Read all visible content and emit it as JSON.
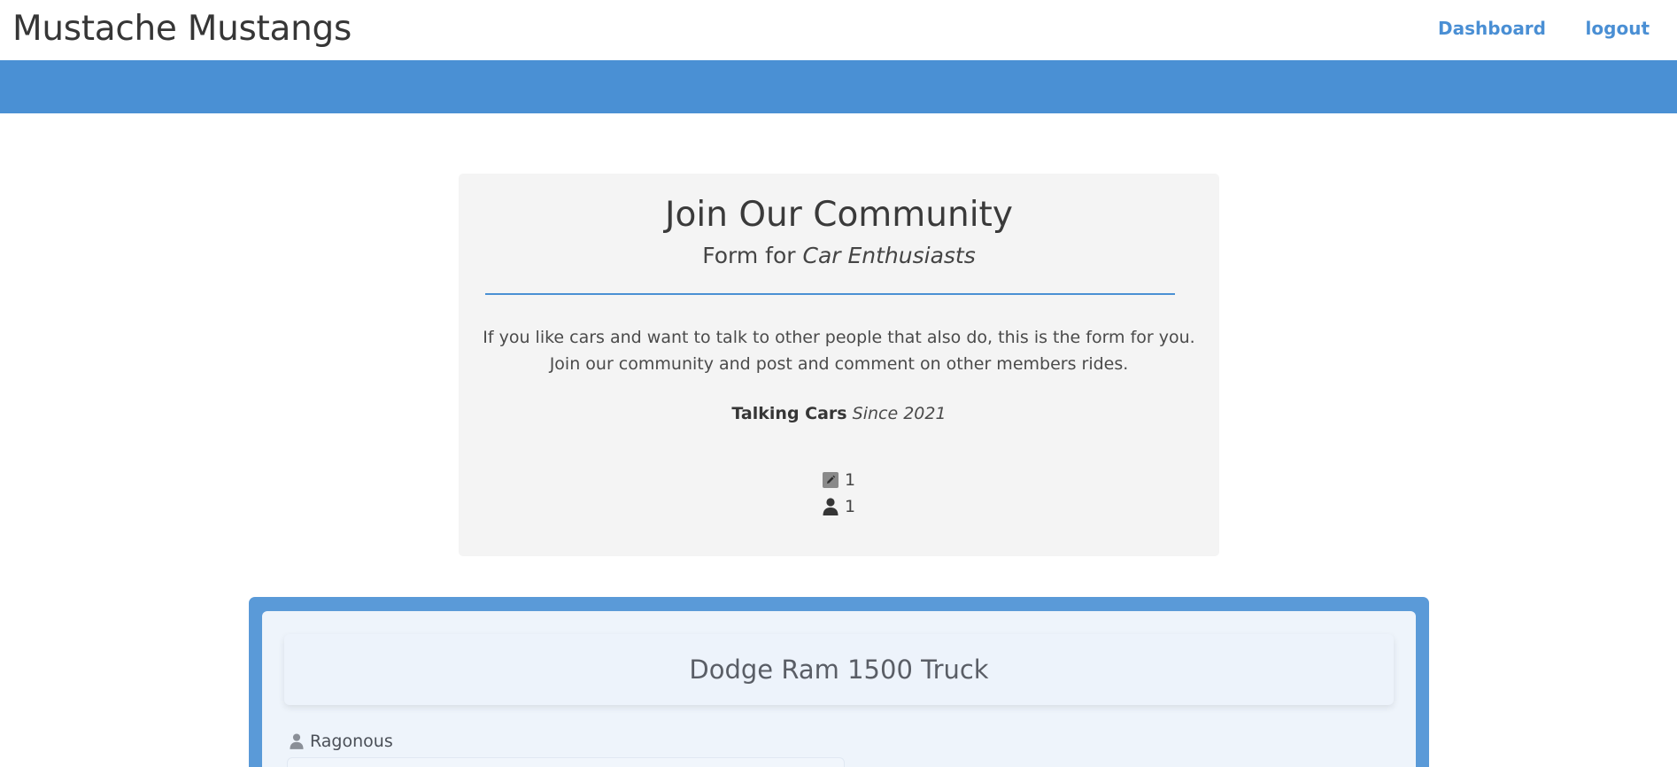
{
  "header": {
    "brand": "Mustache Mustangs",
    "nav": [
      {
        "label": "Dashboard"
      },
      {
        "label": "logout"
      }
    ]
  },
  "intro": {
    "title": "Join Our Community",
    "subtitle_prefix": "Form for ",
    "subtitle_emphasis": "Car Enthusiasts",
    "body_line1": "If you like cars and want to talk to other people that also do, this is the form for you.",
    "body_line2": "Join our community and post and comment on other members rides.",
    "tagline_bold": "Talking Cars",
    "tagline_italic": "Since 2021",
    "post_count": "1",
    "user_count": "1"
  },
  "post": {
    "title": "Dodge Ram 1500 Truck",
    "author": "Ragonous"
  },
  "colors": {
    "accent": "#4a90d4",
    "frame": "#5a9ad8",
    "card": "#eef4fb",
    "intro_bg": "#f4f4f4"
  },
  "icons": {
    "posts": "pencil-square-icon",
    "users": "user-icon"
  }
}
